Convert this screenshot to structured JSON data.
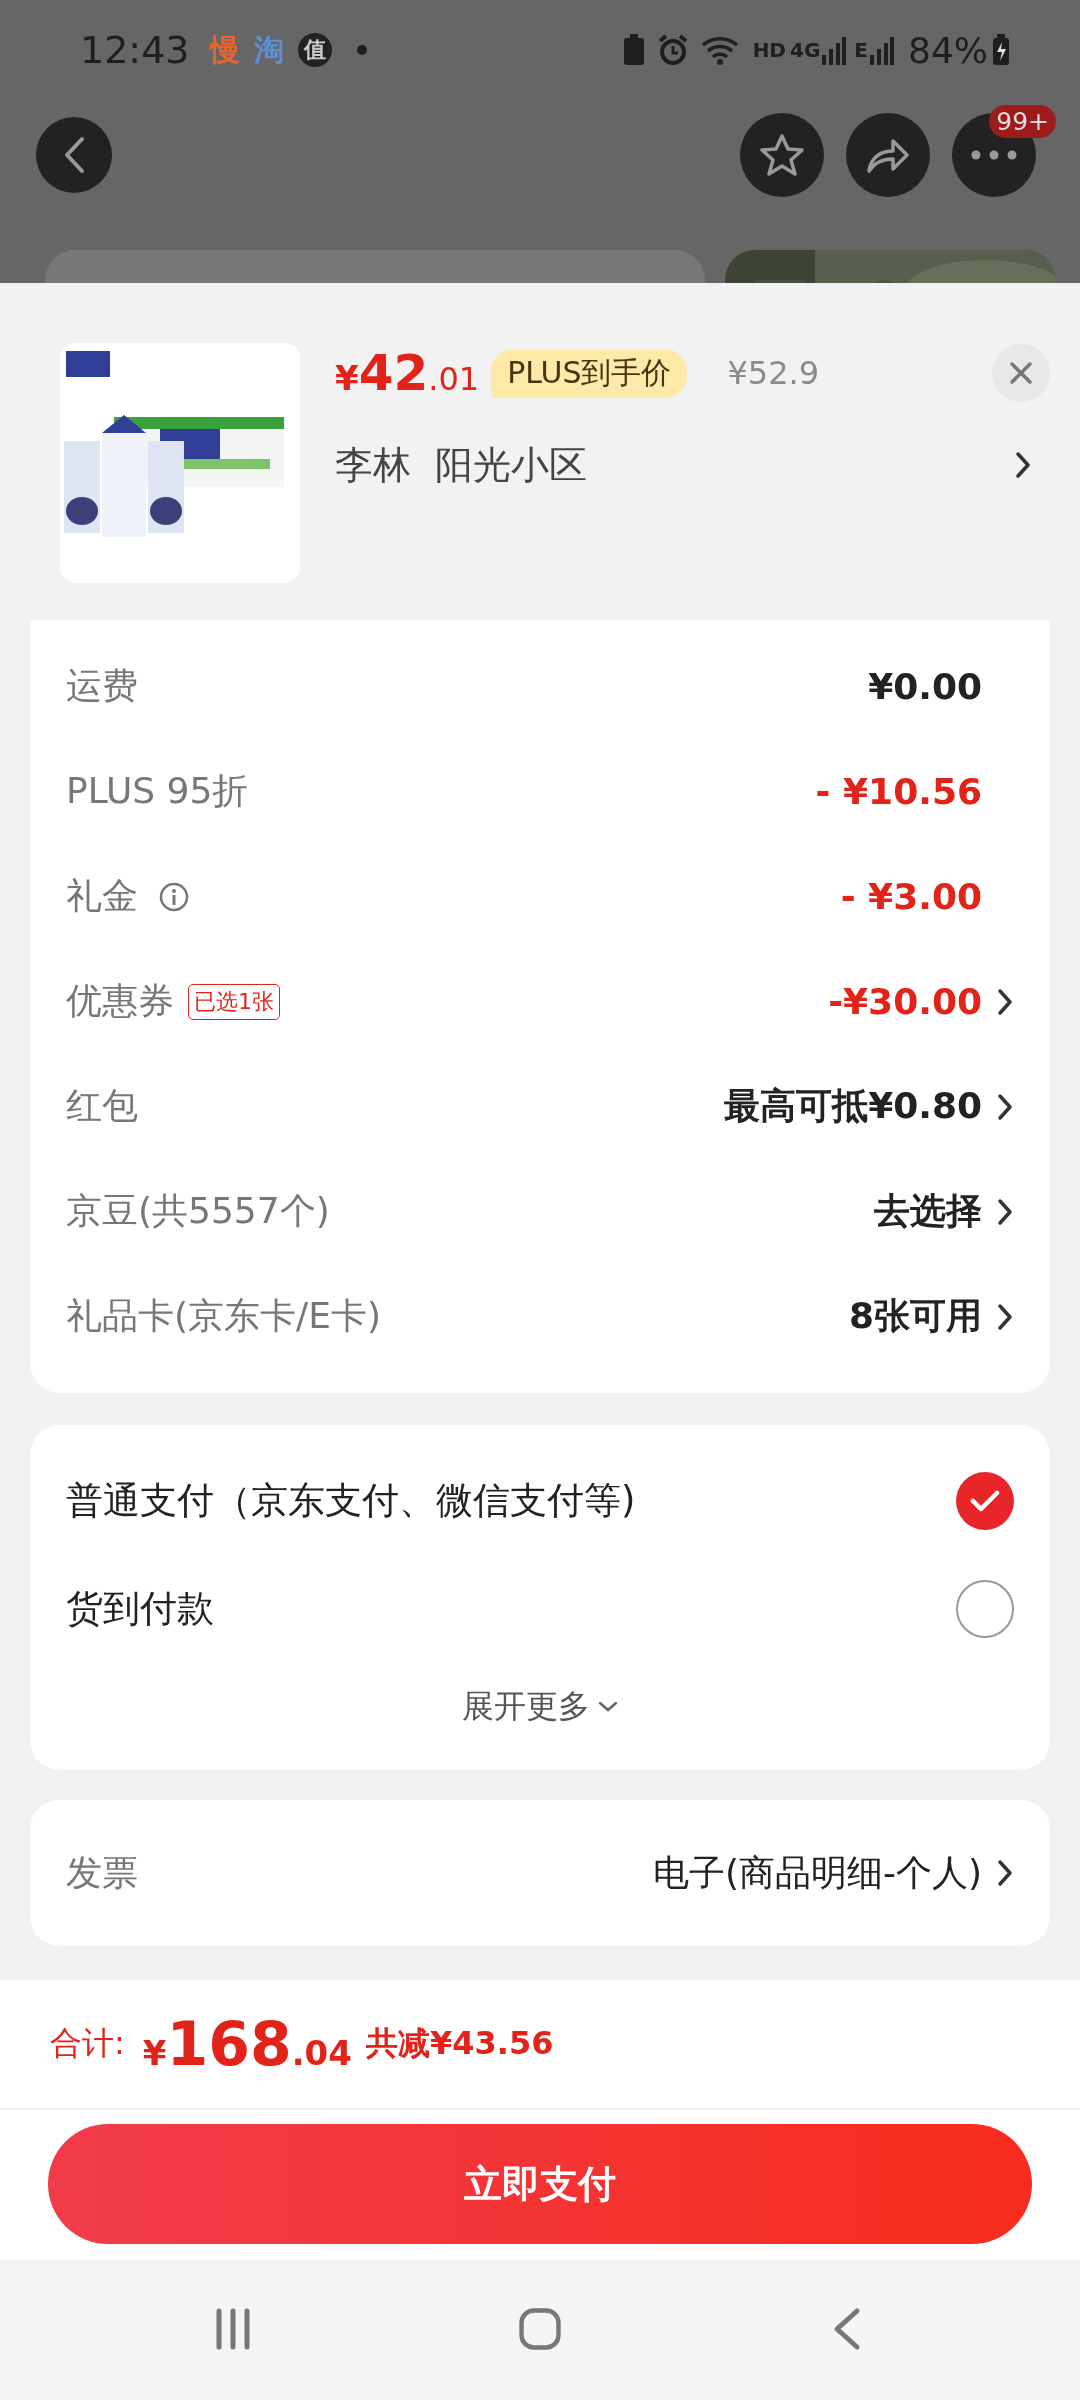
{
  "status_bar": {
    "time": "12:43",
    "apps": [
      {
        "glyph": "慢",
        "kind": "plain",
        "color": "#e8642c"
      },
      {
        "glyph": "淘",
        "kind": "plain",
        "color": "#5b8fd6"
      },
      {
        "glyph": "值",
        "kind": "circle",
        "color": "#222222"
      }
    ],
    "network": [
      "HD",
      "4G",
      "E"
    ],
    "battery": "84%"
  },
  "top_nav": {
    "badge": "99+"
  },
  "product": {
    "price": {
      "symbol": "¥",
      "integer": "42",
      "fraction": ".01"
    },
    "price_tag": "PLUS到手价",
    "original_price": "¥52.9",
    "address": "李林  阳光小区"
  },
  "charges": [
    {
      "label": "运费",
      "value": "¥0.00",
      "discount": false,
      "info": false,
      "chevron": false
    },
    {
      "label": "PLUS 95折",
      "value": "- ¥10.56",
      "discount": true,
      "info": false,
      "chevron": false
    },
    {
      "label": "礼金",
      "value": "- ¥3.00",
      "discount": true,
      "info": true,
      "chevron": false
    },
    {
      "label": "优惠券",
      "tag": "已选1张",
      "value": "-¥30.00",
      "discount": true,
      "info": false,
      "chevron": true
    },
    {
      "label": "红包",
      "value": "最高可抵¥0.80",
      "discount": false,
      "info": false,
      "chevron": true
    },
    {
      "label": "京豆(共5557个)",
      "value": "去选择",
      "discount": false,
      "info": false,
      "chevron": true
    },
    {
      "label": "礼品卡(京东卡/E卡)",
      "value": "8张可用",
      "discount": false,
      "info": false,
      "chevron": true
    }
  ],
  "payment": {
    "options": [
      {
        "label": "普通支付（京东支付、微信支付等)",
        "selected": true
      },
      {
        "label": "货到付款",
        "selected": false
      }
    ],
    "expand": "展开更多"
  },
  "invoice": {
    "label": "发票",
    "value": "电子(商品明细-个人)"
  },
  "footer": {
    "total_label": "合计:",
    "total": {
      "symbol": "¥",
      "integer": "168",
      "fraction": ".04"
    },
    "saving": "共减¥43.56",
    "pay_button": "立即支付"
  }
}
